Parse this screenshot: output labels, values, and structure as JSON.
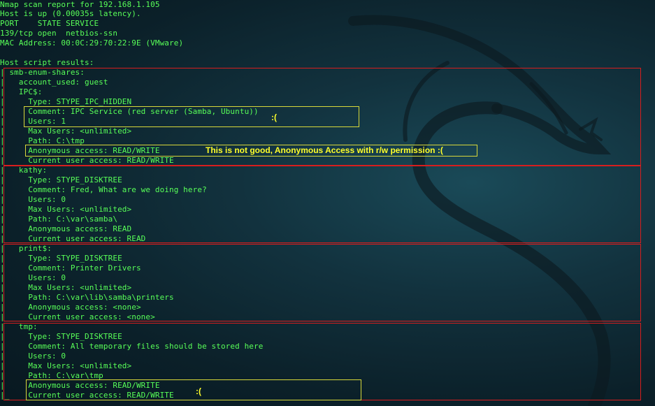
{
  "terminal": {
    "lines": [
      "Nmap scan report for 192.168.1.105",
      "Host is up (0.00035s latency).",
      "PORT    STATE SERVICE",
      "139/tcp open  netbios-ssn",
      "MAC Address: 00:0C:29:70:22:9E (VMware)",
      "",
      "Host script results:",
      "| smb-enum-shares:",
      "|   account_used: guest",
      "|   IPC$:",
      "|     Type: STYPE_IPC_HIDDEN",
      "|     Comment: IPC Service (red server (Samba, Ubuntu))",
      "|     Users: 1",
      "|     Max Users: <unlimited>",
      "|     Path: C:\\tmp",
      "|     Anonymous access: READ/WRITE",
      "|     Current user access: READ/WRITE",
      "|   kathy:",
      "|     Type: STYPE_DISKTREE",
      "|     Comment: Fred, What are we doing here?",
      "|     Users: 0",
      "|     Max Users: <unlimited>",
      "|     Path: C:\\var\\samba\\",
      "|     Anonymous access: READ",
      "|     Current user access: READ",
      "|   print$:",
      "|     Type: STYPE_DISKTREE",
      "|     Comment: Printer Drivers",
      "|     Users: 0",
      "|     Max Users: <unlimited>",
      "|     Path: C:\\var\\lib\\samba\\printers",
      "|     Anonymous access: <none>",
      "|     Current user access: <none>",
      "|   tmp:",
      "|     Type: STYPE_DISKTREE",
      "|     Comment: All temporary files should be stored here",
      "|     Users: 0",
      "|     Max Users: <unlimited>",
      "|     Path: C:\\var\\tmp",
      "|     Anonymous access: READ/WRITE",
      "|_    Current user access: READ/WRITE"
    ]
  },
  "annotations": {
    "ipc_sad": ":(",
    "anon_warning": "This is not good, Anonymous Access with r/w permission :(",
    "tmp_sad": ":("
  },
  "colors": {
    "terminal_text": "#58ff58",
    "highlight_red": "#d81e1e",
    "highlight_yellow": "#d8d83a",
    "note_text": "#ffff2a"
  }
}
